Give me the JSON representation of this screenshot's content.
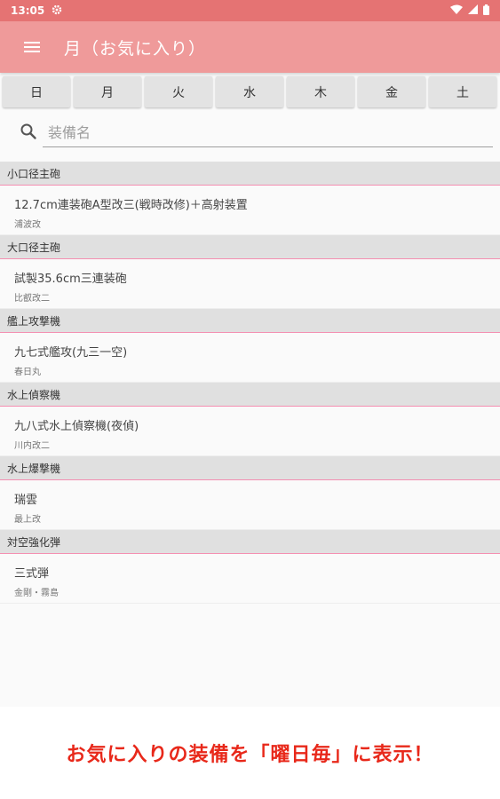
{
  "status": {
    "time": "13:05"
  },
  "appbar": {
    "title": "月（お気に入り）"
  },
  "days": [
    "日",
    "月",
    "火",
    "水",
    "木",
    "金",
    "土"
  ],
  "search": {
    "placeholder": "装備名"
  },
  "sections": [
    {
      "header": "小口径主砲",
      "items": [
        {
          "name": "12.7cm連装砲A型改三(戦時改修)＋高射装置",
          "ship": "浦波改"
        }
      ]
    },
    {
      "header": "大口径主砲",
      "items": [
        {
          "name": "試製35.6cm三連装砲",
          "ship": "比叡改二"
        }
      ]
    },
    {
      "header": "艦上攻撃機",
      "items": [
        {
          "name": "九七式艦攻(九三一空)",
          "ship": "春日丸"
        }
      ]
    },
    {
      "header": "水上偵察機",
      "items": [
        {
          "name": "九八式水上偵察機(夜偵)",
          "ship": "川内改二"
        }
      ]
    },
    {
      "header": "水上爆撃機",
      "items": [
        {
          "name": "瑞雲",
          "ship": "最上改"
        }
      ]
    },
    {
      "header": "対空強化弾",
      "items": [
        {
          "name": "三式弾",
          "ship": "金剛・霧島"
        }
      ]
    }
  ],
  "caption": "お気に入りの装備を「曜日毎」に表示！",
  "colors": {
    "statusbar": "#e57373",
    "appbar": "#ef9a9a",
    "caption": "#e8281a"
  }
}
